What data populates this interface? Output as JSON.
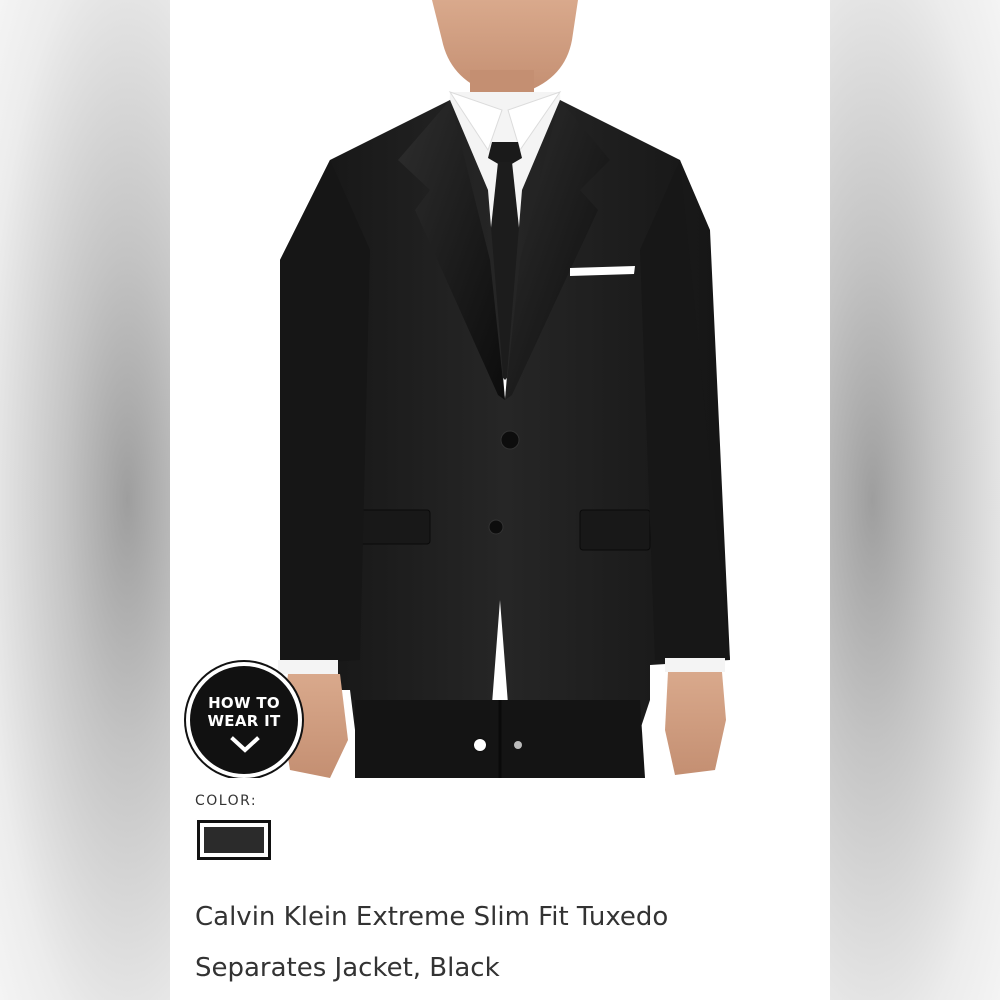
{
  "product": {
    "image_alt_icon": "tuxedo-jacket-photo",
    "how_to_wear": {
      "line1": "HOW TO",
      "line2": "WEAR IT",
      "icon": "chevron-down-icon"
    },
    "carousel": {
      "total": 2,
      "current": 1
    },
    "color": {
      "label": "COLOR:",
      "selected_swatch": "#2b2b2b"
    },
    "title_line1": "Calvin Klein Extreme Slim Fit Tuxedo",
    "title_line2": "Separates Jacket, Black"
  },
  "colors": {
    "background": "#ffffff",
    "text": "#333333",
    "badge": "#111111"
  }
}
